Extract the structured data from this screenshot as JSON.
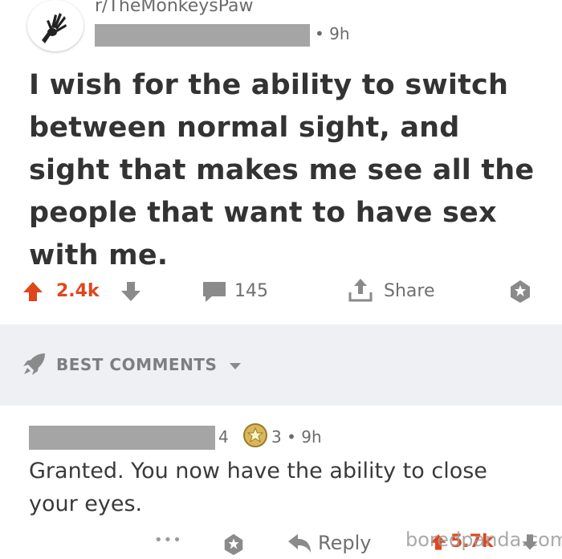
{
  "post": {
    "subreddit": "r/TheMonkeysPaw",
    "separator": "•",
    "age": "9h",
    "title": "I wish for the ability to switch between normal sight, and sight that makes me see all the people that want to have sex with me."
  },
  "actions": {
    "upvotes": "2.4k",
    "comments": "145",
    "share_label": "Share"
  },
  "comments_section": {
    "sort_label": "BEST COMMENTS"
  },
  "comment": {
    "flair_number": "4",
    "award_count": "3",
    "separator": "•",
    "age": "9h",
    "body": "Granted. You now have the ability to close your eyes.",
    "more_label": "•••",
    "reply_label": "Reply",
    "score": "5.7k"
  },
  "watermark": "boredpanda.com",
  "colors": {
    "upvote": "#e0461c",
    "band": "#eef0f3",
    "redaction": "#a5a5a5",
    "icon_gray": "#8a8a8a"
  }
}
